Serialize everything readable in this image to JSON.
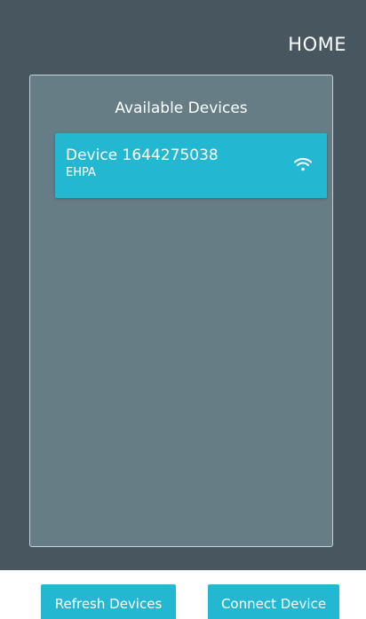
{
  "header": {
    "title": "HOME"
  },
  "devices_panel": {
    "title": "Available Devices",
    "devices": [
      {
        "name": "Device 1644275038",
        "subtitle": "EHPA",
        "icon": "wifi-icon"
      }
    ]
  },
  "footer": {
    "refresh_label": "Refresh Devices",
    "connect_label": "Connect Device"
  },
  "colors": {
    "background": "#47565f",
    "panel": "#677d86",
    "accent": "#22b8d2",
    "text": "#ffffff"
  }
}
